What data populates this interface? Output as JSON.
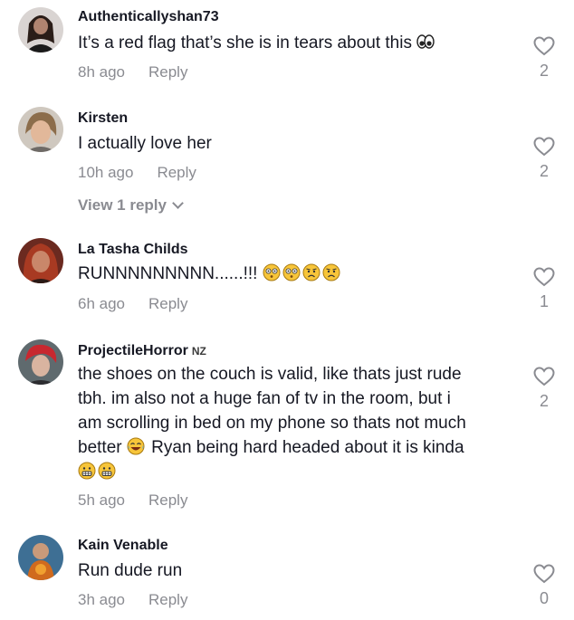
{
  "comments": [
    {
      "username": "Authenticallyshan73",
      "badge": "",
      "text_lines": [
        "It’s a red flag that’s she is in tears about this"
      ],
      "time": "8h ago",
      "reply_label": "Reply",
      "likes": "2",
      "emojis": [
        "eyes-emoji"
      ]
    },
    {
      "username": "Kirsten",
      "badge": "",
      "text_lines": [
        "I actually love her"
      ],
      "time": "10h ago",
      "reply_label": "Reply",
      "likes": "2",
      "view_replies": "View 1 reply"
    },
    {
      "username": "La Tasha Childs",
      "badge": "",
      "text_lines": [
        "RUNNNNNNNNN......!!!"
      ],
      "time": "6h ago",
      "reply_label": "Reply",
      "likes": "1",
      "emojis": [
        "flushed-face-emoji",
        "flushed-face-emoji",
        "worried-face-emoji",
        "worried-face-emoji"
      ]
    },
    {
      "username": "ProjectileHorror",
      "badge": "NZ",
      "text_lines": [
        "the shoes on the couch is valid, like thats just rude",
        "tbh. im also not a huge fan of tv in the room, but i",
        "am scrolling in bed on my phone so thats not much",
        "better",
        "Ryan being hard headed about it is kinda"
      ],
      "time": "5h ago",
      "reply_label": "Reply",
      "likes": "2",
      "emojis": [
        "grimacing-face-emoji",
        "grimacing-face-emoji"
      ]
    },
    {
      "username": "Kain Venable",
      "badge": "",
      "text_lines": [
        "Run dude run"
      ],
      "time": "3h ago",
      "reply_label": "Reply",
      "likes": "0"
    }
  ],
  "colors": {
    "text": "#161823",
    "muted": "#8a8b91",
    "background": "#ffffff"
  }
}
